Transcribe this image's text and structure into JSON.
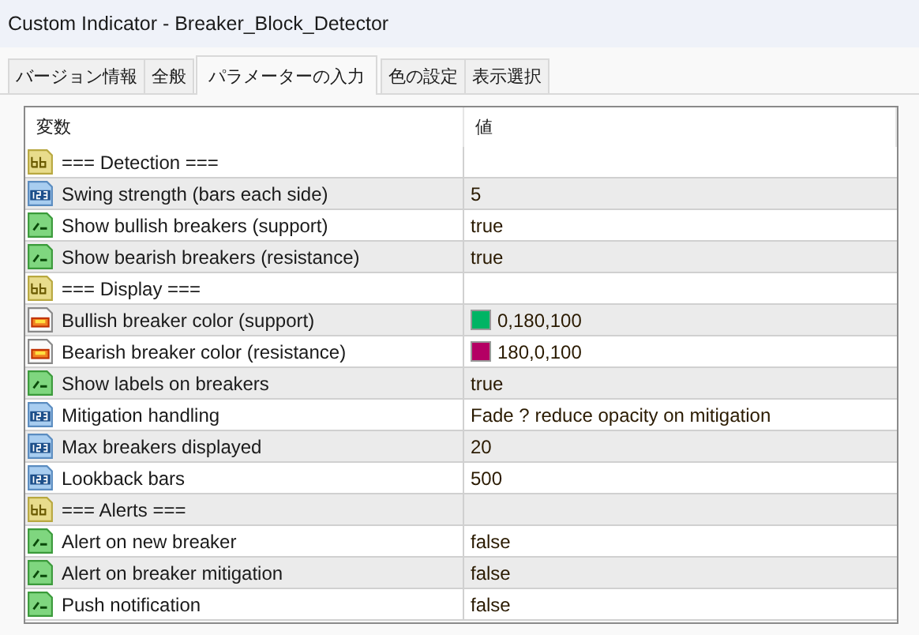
{
  "window": {
    "title": "Custom Indicator - Breaker_Block_Detector"
  },
  "tabs": [
    {
      "label": "バージョン情報",
      "selected": false
    },
    {
      "label": "全般",
      "selected": false
    },
    {
      "label": "パラメーターの入力",
      "selected": true
    },
    {
      "label": "色の設定",
      "selected": false
    },
    {
      "label": "表示選択",
      "selected": false
    }
  ],
  "table": {
    "columns": [
      "変数",
      "値"
    ],
    "rows": [
      {
        "kind": "string",
        "name": "=== Detection ==="
      },
      {
        "kind": "int",
        "name": "Swing strength (bars each side)",
        "value": "5"
      },
      {
        "kind": "bool",
        "name": "Show bullish breakers (support)",
        "value": "true"
      },
      {
        "kind": "bool",
        "name": "Show bearish breakers (resistance)",
        "value": "true"
      },
      {
        "kind": "string",
        "name": "=== Display ==="
      },
      {
        "kind": "color",
        "name": "Bullish breaker color (support)",
        "value": "0,180,100",
        "color": "#00b464"
      },
      {
        "kind": "color",
        "name": "Bearish breaker color (resistance)",
        "value": "180,0,100",
        "color": "#b40064"
      },
      {
        "kind": "bool",
        "name": "Show labels on breakers",
        "value": "true"
      },
      {
        "kind": "int",
        "name": "Mitigation handling",
        "value": "Fade ? reduce opacity on mitigation"
      },
      {
        "kind": "int",
        "name": "Max breakers displayed",
        "value": "20"
      },
      {
        "kind": "int",
        "name": "Lookback bars",
        "value": "500"
      },
      {
        "kind": "string",
        "name": "=== Alerts ==="
      },
      {
        "kind": "bool",
        "name": "Alert on new breaker",
        "value": "false"
      },
      {
        "kind": "bool",
        "name": "Alert on breaker mitigation",
        "value": "false"
      },
      {
        "kind": "bool",
        "name": "Push notification",
        "value": "false"
      }
    ]
  }
}
